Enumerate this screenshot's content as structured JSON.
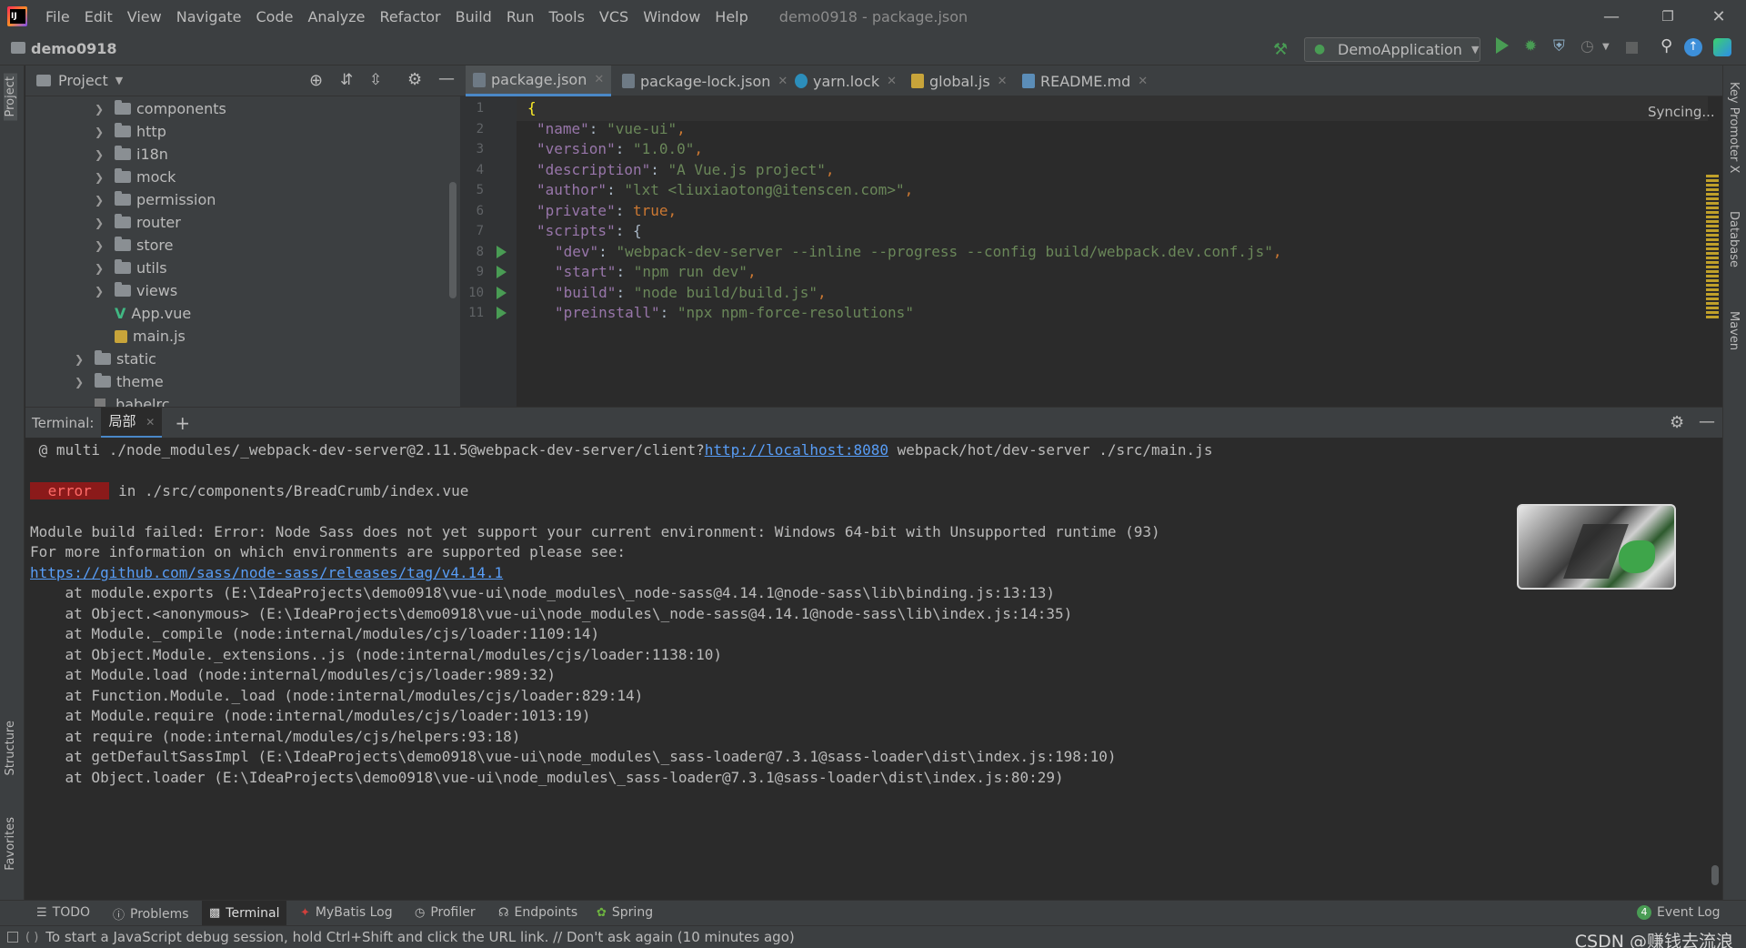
{
  "menu": {
    "items": [
      "File",
      "Edit",
      "View",
      "Navigate",
      "Code",
      "Analyze",
      "Refactor",
      "Build",
      "Run",
      "Tools",
      "VCS",
      "Window",
      "Help"
    ],
    "window_title": "demo0918 - package.json"
  },
  "navbar": {
    "project_name": "demo0918",
    "run_config": "DemoApplication"
  },
  "project_panel": {
    "title": "Project",
    "tree": [
      {
        "label": "components",
        "type": "folder",
        "indent": 1
      },
      {
        "label": "http",
        "type": "folder",
        "indent": 1
      },
      {
        "label": "i18n",
        "type": "folder",
        "indent": 1
      },
      {
        "label": "mock",
        "type": "folder",
        "indent": 1
      },
      {
        "label": "permission",
        "type": "folder",
        "indent": 1
      },
      {
        "label": "router",
        "type": "folder",
        "indent": 1
      },
      {
        "label": "store",
        "type": "folder",
        "indent": 1
      },
      {
        "label": "utils",
        "type": "folder",
        "indent": 1
      },
      {
        "label": "views",
        "type": "folder",
        "indent": 1
      },
      {
        "label": "App.vue",
        "type": "vue",
        "indent": 1
      },
      {
        "label": "main.js",
        "type": "js",
        "indent": 1
      },
      {
        "label": "static",
        "type": "folder",
        "indent": 0
      },
      {
        "label": "theme",
        "type": "folder",
        "indent": 0
      },
      {
        "label": ".babelrc",
        "type": "file",
        "indent": 0
      }
    ]
  },
  "editor": {
    "tabs": [
      {
        "label": "package.json",
        "active": true
      },
      {
        "label": "package-lock.json",
        "active": false
      },
      {
        "label": "yarn.lock",
        "active": false
      },
      {
        "label": "global.js",
        "active": false
      },
      {
        "label": "README.md",
        "active": false
      }
    ],
    "syncing": "Syncing...",
    "lines": [
      {
        "n": "1",
        "key": "",
        "val": "",
        "raw": "{"
      },
      {
        "n": "2",
        "key": "\"name\"",
        "val": "\"vue-ui\"",
        "raw": ""
      },
      {
        "n": "3",
        "key": "\"version\"",
        "val": "\"1.0.0\"",
        "raw": ""
      },
      {
        "n": "4",
        "key": "\"description\"",
        "val": "\"A Vue.js project\"",
        "raw": ""
      },
      {
        "n": "5",
        "key": "\"author\"",
        "val": "\"lxt <liuxiaotong@itenscen.com>\"",
        "raw": ""
      },
      {
        "n": "6",
        "key": "\"private\"",
        "val": "true",
        "raw": ""
      },
      {
        "n": "7",
        "key": "\"scripts\"",
        "val": "{",
        "raw": ""
      },
      {
        "n": "8",
        "key": "\"dev\"",
        "val": "\"webpack-dev-server --inline --progress --config build/webpack.dev.conf.js\"",
        "raw": ""
      },
      {
        "n": "9",
        "key": "\"start\"",
        "val": "\"npm run dev\"",
        "raw": ""
      },
      {
        "n": "10",
        "key": "\"build\"",
        "val": "\"node build/build.js\"",
        "raw": ""
      },
      {
        "n": "11",
        "key": "\"preinstall\"",
        "val": "\"npx npm-force-resolutions\"",
        "raw": ""
      }
    ]
  },
  "terminal": {
    "label": "Terminal:",
    "tab": "局部",
    "line_multi_prefix": " @ multi ./node_modules/_webpack-dev-server@2.11.5@webpack-dev-server/client?",
    "line_multi_link": "http://localhost:8080",
    "line_multi_suffix": " webpack/hot/dev-server ./src/main.js",
    "error_badge": " error ",
    "error_location": " in ./src/components/BreadCrumb/index.vue",
    "module_failed": "Module build failed: Error: Node Sass does not yet support your current environment: Windows 64-bit with Unsupported runtime (93)",
    "more_info": "For more information on which environments are supported please see:",
    "info_link": "https://github.com/sass/node-sass/releases/tag/v4.14.1",
    "stack": [
      "    at module.exports (E:\\IdeaProjects\\demo0918\\vue-ui\\node_modules\\_node-sass@4.14.1@node-sass\\lib\\binding.js:13:13)",
      "    at Object.<anonymous> (E:\\IdeaProjects\\demo0918\\vue-ui\\node_modules\\_node-sass@4.14.1@node-sass\\lib\\index.js:14:35)",
      "    at Module._compile (node:internal/modules/cjs/loader:1109:14)",
      "    at Object.Module._extensions..js (node:internal/modules/cjs/loader:1138:10)",
      "    at Module.load (node:internal/modules/cjs/loader:989:32)",
      "    at Function.Module._load (node:internal/modules/cjs/loader:829:14)",
      "    at Module.require (node:internal/modules/cjs/loader:1013:19)",
      "    at require (node:internal/modules/cjs/helpers:93:18)",
      "    at getDefaultSassImpl (E:\\IdeaProjects\\demo0918\\vue-ui\\node_modules\\_sass-loader@7.3.1@sass-loader\\dist\\index.js:198:10)",
      "    at Object.loader (E:\\IdeaProjects\\demo0918\\vue-ui\\node_modules\\_sass-loader@7.3.1@sass-loader\\dist\\index.js:80:29)"
    ]
  },
  "left_stripe": {
    "project": "Project",
    "structure": "Structure",
    "favorites": "Favorites"
  },
  "right_stripe": {
    "key_promoter": "Key Promoter X",
    "database": "Database",
    "maven": "Maven"
  },
  "bottom_tools": {
    "todo": "TODO",
    "problems": "Problems",
    "terminal": "Terminal",
    "mybatis": "MyBatis Log",
    "profiler": "Profiler",
    "endpoints": "Endpoints",
    "spring": "Spring",
    "event_log": "Event Log",
    "event_count": "4"
  },
  "status": {
    "message": "To start a JavaScript debug session, hold Ctrl+Shift and click the URL link. // Don't ask again (10 minutes ago)",
    "watermark": "CSDN @赚钱去流浪"
  },
  "colors": {
    "accent": "#4a88c7",
    "run_green": "#499c54",
    "error_red": "#ff6b68",
    "link": "#589df6"
  }
}
